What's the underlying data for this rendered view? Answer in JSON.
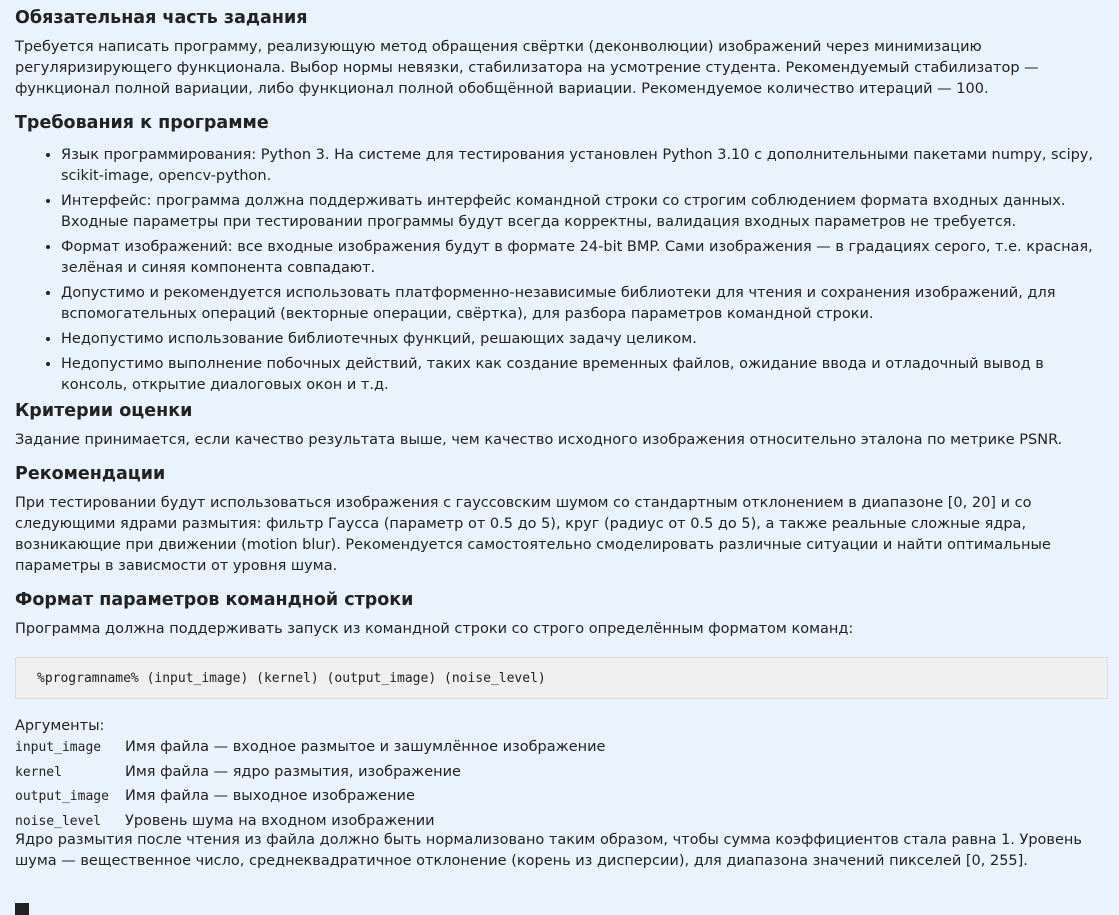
{
  "section1": {
    "title": "Обязательная часть задания",
    "body": "Требуется написать программу, реализующую метод обращения свёртки (деконволюции) изображений через минимизацию регуляризирующего функционала. Выбор нормы невязки, стабилизатора на усмотрение студента. Рекомендуемый стабилизатор — функционал полной вариации, либо функционал полной обобщённой вариации. Рекомендуемое количество итераций — 100."
  },
  "section2": {
    "title": "Требования к программе",
    "items": [
      "Язык программирования: Python 3. На системе для тестирования установлен Python 3.10 с дополнительными пакетами numpy, scipy, scikit-image, opencv-python.",
      "Интерфейс: программа должна поддерживать интерфейс командной строки со строгим соблюдением формата входных данных. Входные параметры при тестировании программы будут всегда корректны, валидация входных параметров не требуется.",
      "Формат изображений: все входные изображения будут в формате 24-bit BMP. Сами изображения — в градациях серого, т.е. красная, зелёная и синяя компонента совпадают.",
      "Допустимо и рекомендуется использовать платформенно-независимые библиотеки для чтения и сохранения изображений, для вспомогательных операций (векторные операции, свёртка), для разбора параметров командной строки.",
      "Недопустимо использование библиотечных функций, решающих задачу целиком.",
      "Недопустимо выполнение побочных действий, таких как создание временных файлов, ожидание ввода и отладочный вывод в консоль, открытие диалоговых окон и т.д."
    ]
  },
  "section3": {
    "title": "Критерии оценки",
    "body": "Задание принимается, если качество результата выше, чем качество исходного изображения относительно эталона по метрике PSNR."
  },
  "section4": {
    "title": "Рекомендации",
    "body": "При тестировании будут использоваться изображения с гауссовским шумом со стандартным отклонением в диапазоне [0, 20] и со следующими ядрами размытия: фильтр Гаусса (параметр от 0.5 до 5), круг (радиус от 0.5 до 5), а также реальные сложные ядра, возникающие при движении (motion blur). Рекомендуется самостоятельно смоделировать различные ситуации и найти оптимальные параметры в зависмости от уровня шума."
  },
  "section5": {
    "title": "Формат параметров командной строки",
    "intro": "Программа должна поддерживать запуск из командной строки со строго определённым форматом команд:",
    "command": "%programname% (input_image) (kernel) (output_image) (noise_level)",
    "args_label": "Аргументы:",
    "args": [
      {
        "name": "input_image",
        "desc": "Имя файла — входное размытое и зашумлённое изображение"
      },
      {
        "name": "kernel",
        "desc": "Имя файла — ядро размытия, изображение"
      },
      {
        "name": "output_image",
        "desc": "Имя файла — выходное изображение"
      },
      {
        "name": "noise_level",
        "desc": "Уровень шума на входном изображении"
      }
    ],
    "note": "Ядро размытия после чтения из файла должно быть нормализовано таким образом, чтобы сумма коэффициентов стала равна 1. Уровень шума — вещественное число, среднеквадратичное отклонение (корень из дисперсии), для диапазона значений пикселей [0, 255]."
  }
}
